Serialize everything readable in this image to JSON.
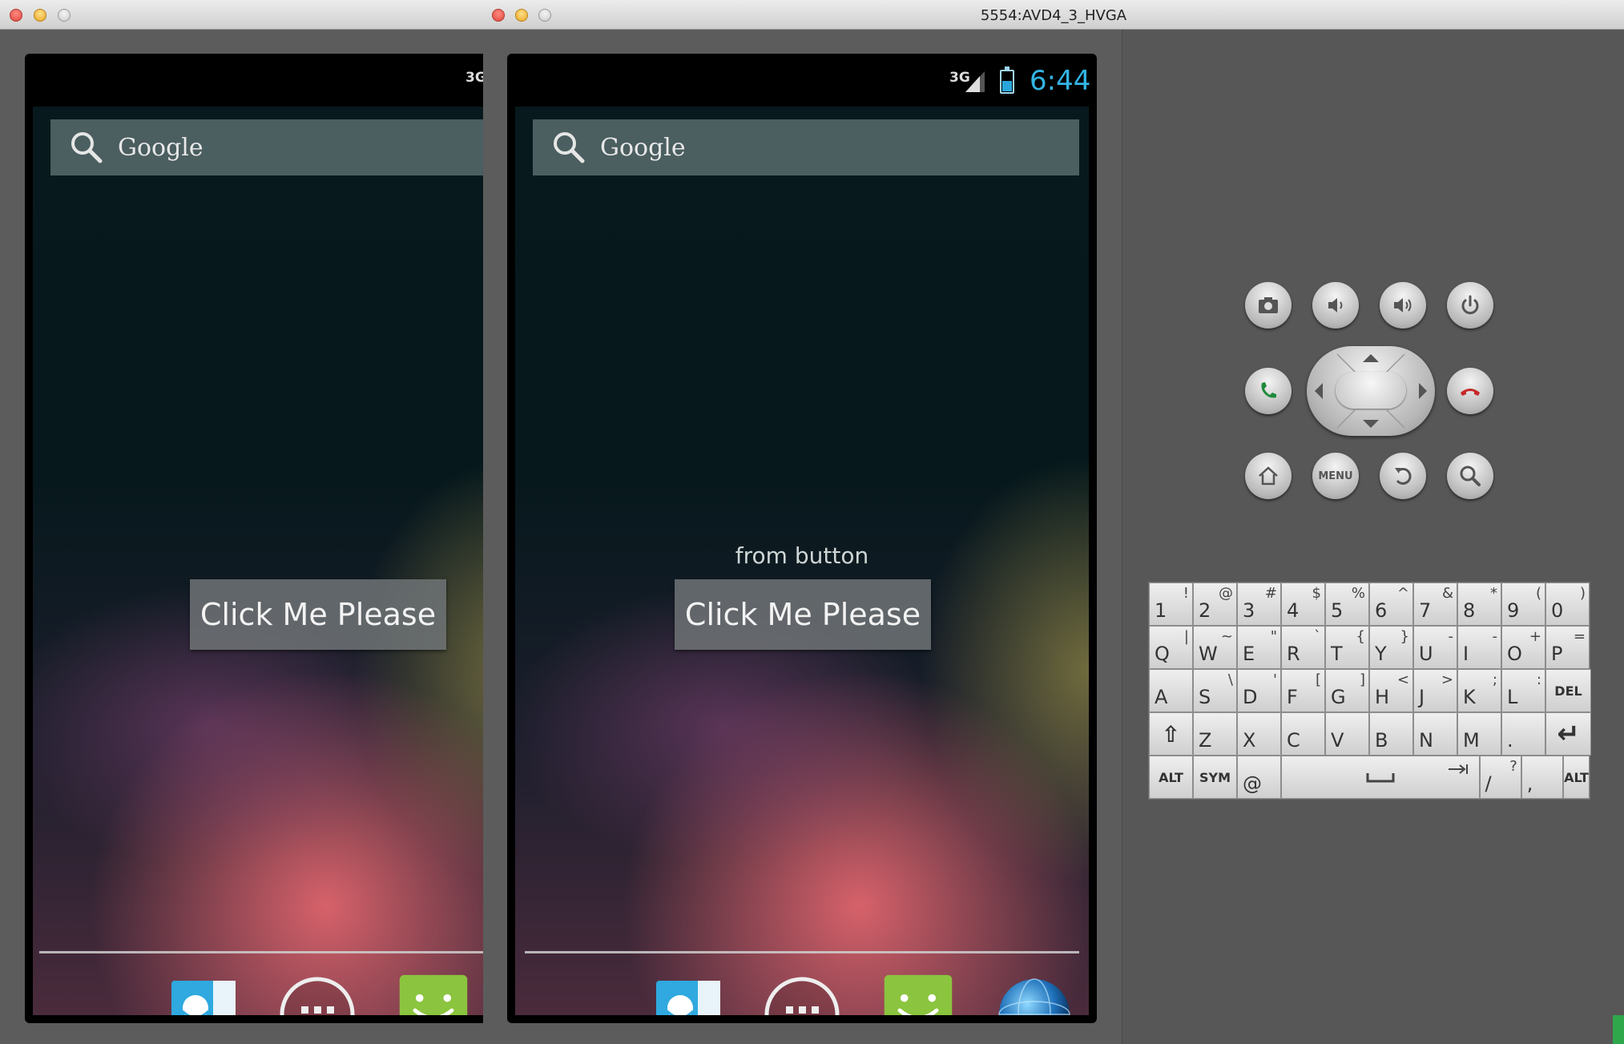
{
  "window_back": {
    "title": ""
  },
  "window_front": {
    "title": "5554:AVD4_3_HVGA"
  },
  "phone": {
    "status": {
      "network": "3G",
      "time": "6:44"
    },
    "search": {
      "label": "Google"
    },
    "toast": "from button",
    "button_label": "Click Me Please",
    "dock": [
      "contacts-icon",
      "app-drawer-icon",
      "messaging-icon",
      "browser-icon"
    ]
  },
  "controls": {
    "row1": [
      "camera-icon",
      "volume-down-icon",
      "volume-up-icon",
      "power-icon"
    ],
    "row2": [
      "call-icon",
      "dpad",
      "end-call-icon"
    ],
    "row3": [
      "home-icon",
      "menu-button",
      "back-icon",
      "search-icon"
    ],
    "menu_label": "MENU"
  },
  "keyboard": {
    "row1": [
      [
        "1",
        "!"
      ],
      [
        "2",
        "@"
      ],
      [
        "3",
        "#"
      ],
      [
        "4",
        "$"
      ],
      [
        "5",
        "%"
      ],
      [
        "6",
        "^"
      ],
      [
        "7",
        "&"
      ],
      [
        "8",
        "*"
      ],
      [
        "9",
        "("
      ],
      [
        "0",
        ")"
      ]
    ],
    "row2": [
      [
        "Q",
        "|"
      ],
      [
        "W",
        "~"
      ],
      [
        "E",
        "\""
      ],
      [
        "R",
        "`"
      ],
      [
        "T",
        "{"
      ],
      [
        "Y",
        "}"
      ],
      [
        "U",
        "-"
      ],
      [
        "I",
        "-"
      ],
      [
        "O",
        "+"
      ],
      [
        "P",
        "="
      ]
    ],
    "row3": [
      [
        "A",
        ""
      ],
      [
        "S",
        "\\"
      ],
      [
        "D",
        "'"
      ],
      [
        "F",
        "["
      ],
      [
        "G",
        "]"
      ],
      [
        "H",
        "<"
      ],
      [
        "J",
        ">"
      ],
      [
        "K",
        ";"
      ],
      [
        "L",
        ":"
      ]
    ],
    "row3_del": "DEL",
    "row4": [
      [
        "Z",
        ""
      ],
      [
        "X",
        ""
      ],
      [
        "C",
        ""
      ],
      [
        "V",
        ""
      ],
      [
        "B",
        ""
      ],
      [
        "N",
        ""
      ],
      [
        "M",
        ""
      ],
      [
        ".",
        ""
      ]
    ],
    "alt": "ALT",
    "sym": "SYM",
    "at": "@",
    "slash": "/",
    "question": "?",
    "comma": ","
  }
}
